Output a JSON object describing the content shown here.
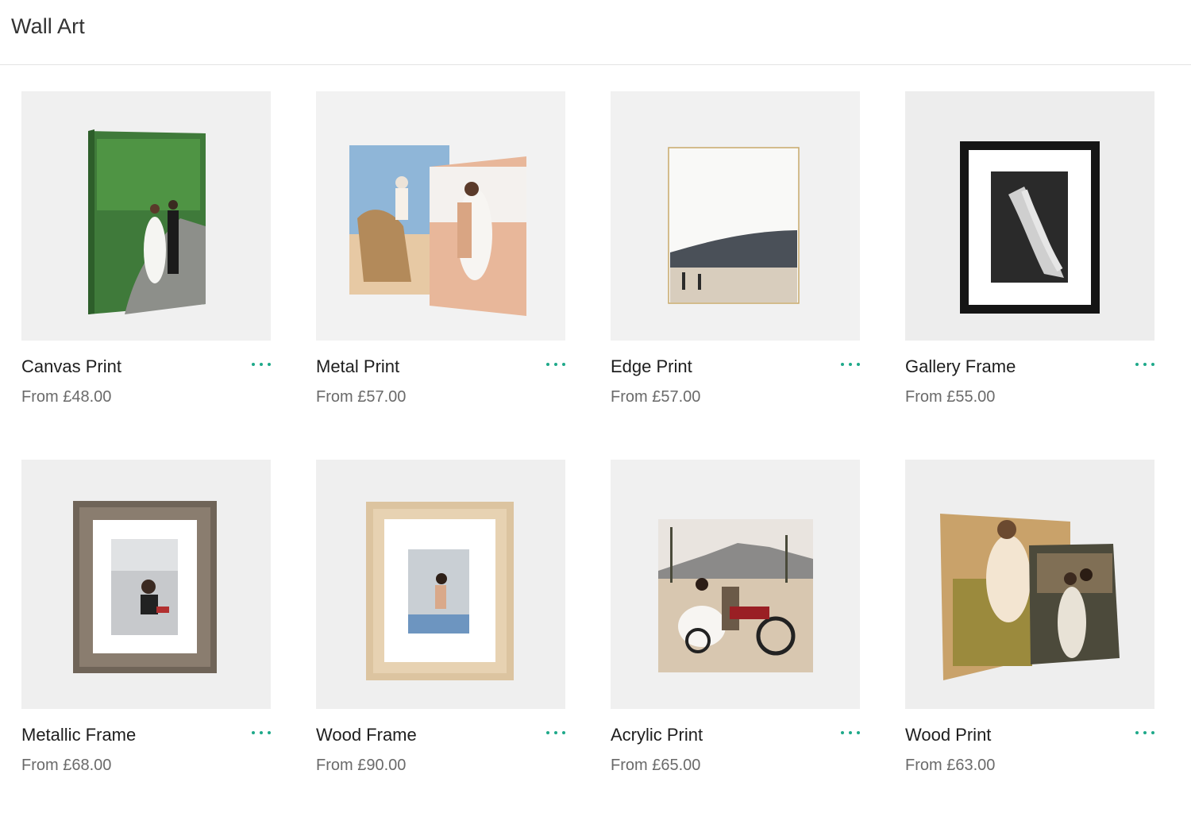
{
  "page": {
    "title": "Wall Art"
  },
  "colors": {
    "accent": "#1fa98a",
    "tile_bg": "#efefef"
  },
  "products": [
    {
      "name": "Canvas Print",
      "price": "From £48.00",
      "icon": "more-options-icon"
    },
    {
      "name": "Metal Print",
      "price": "From £57.00",
      "icon": "more-options-icon"
    },
    {
      "name": "Edge Print",
      "price": "From £57.00",
      "icon": "more-options-icon"
    },
    {
      "name": "Gallery Frame",
      "price": "From £55.00",
      "icon": "more-options-icon"
    },
    {
      "name": "Metallic Frame",
      "price": "From £68.00",
      "icon": "more-options-icon"
    },
    {
      "name": "Wood Frame",
      "price": "From £90.00",
      "icon": "more-options-icon"
    },
    {
      "name": "Acrylic Print",
      "price": "From £65.00",
      "icon": "more-options-icon"
    },
    {
      "name": "Wood Print",
      "price": "From £63.00",
      "icon": "more-options-icon"
    }
  ]
}
